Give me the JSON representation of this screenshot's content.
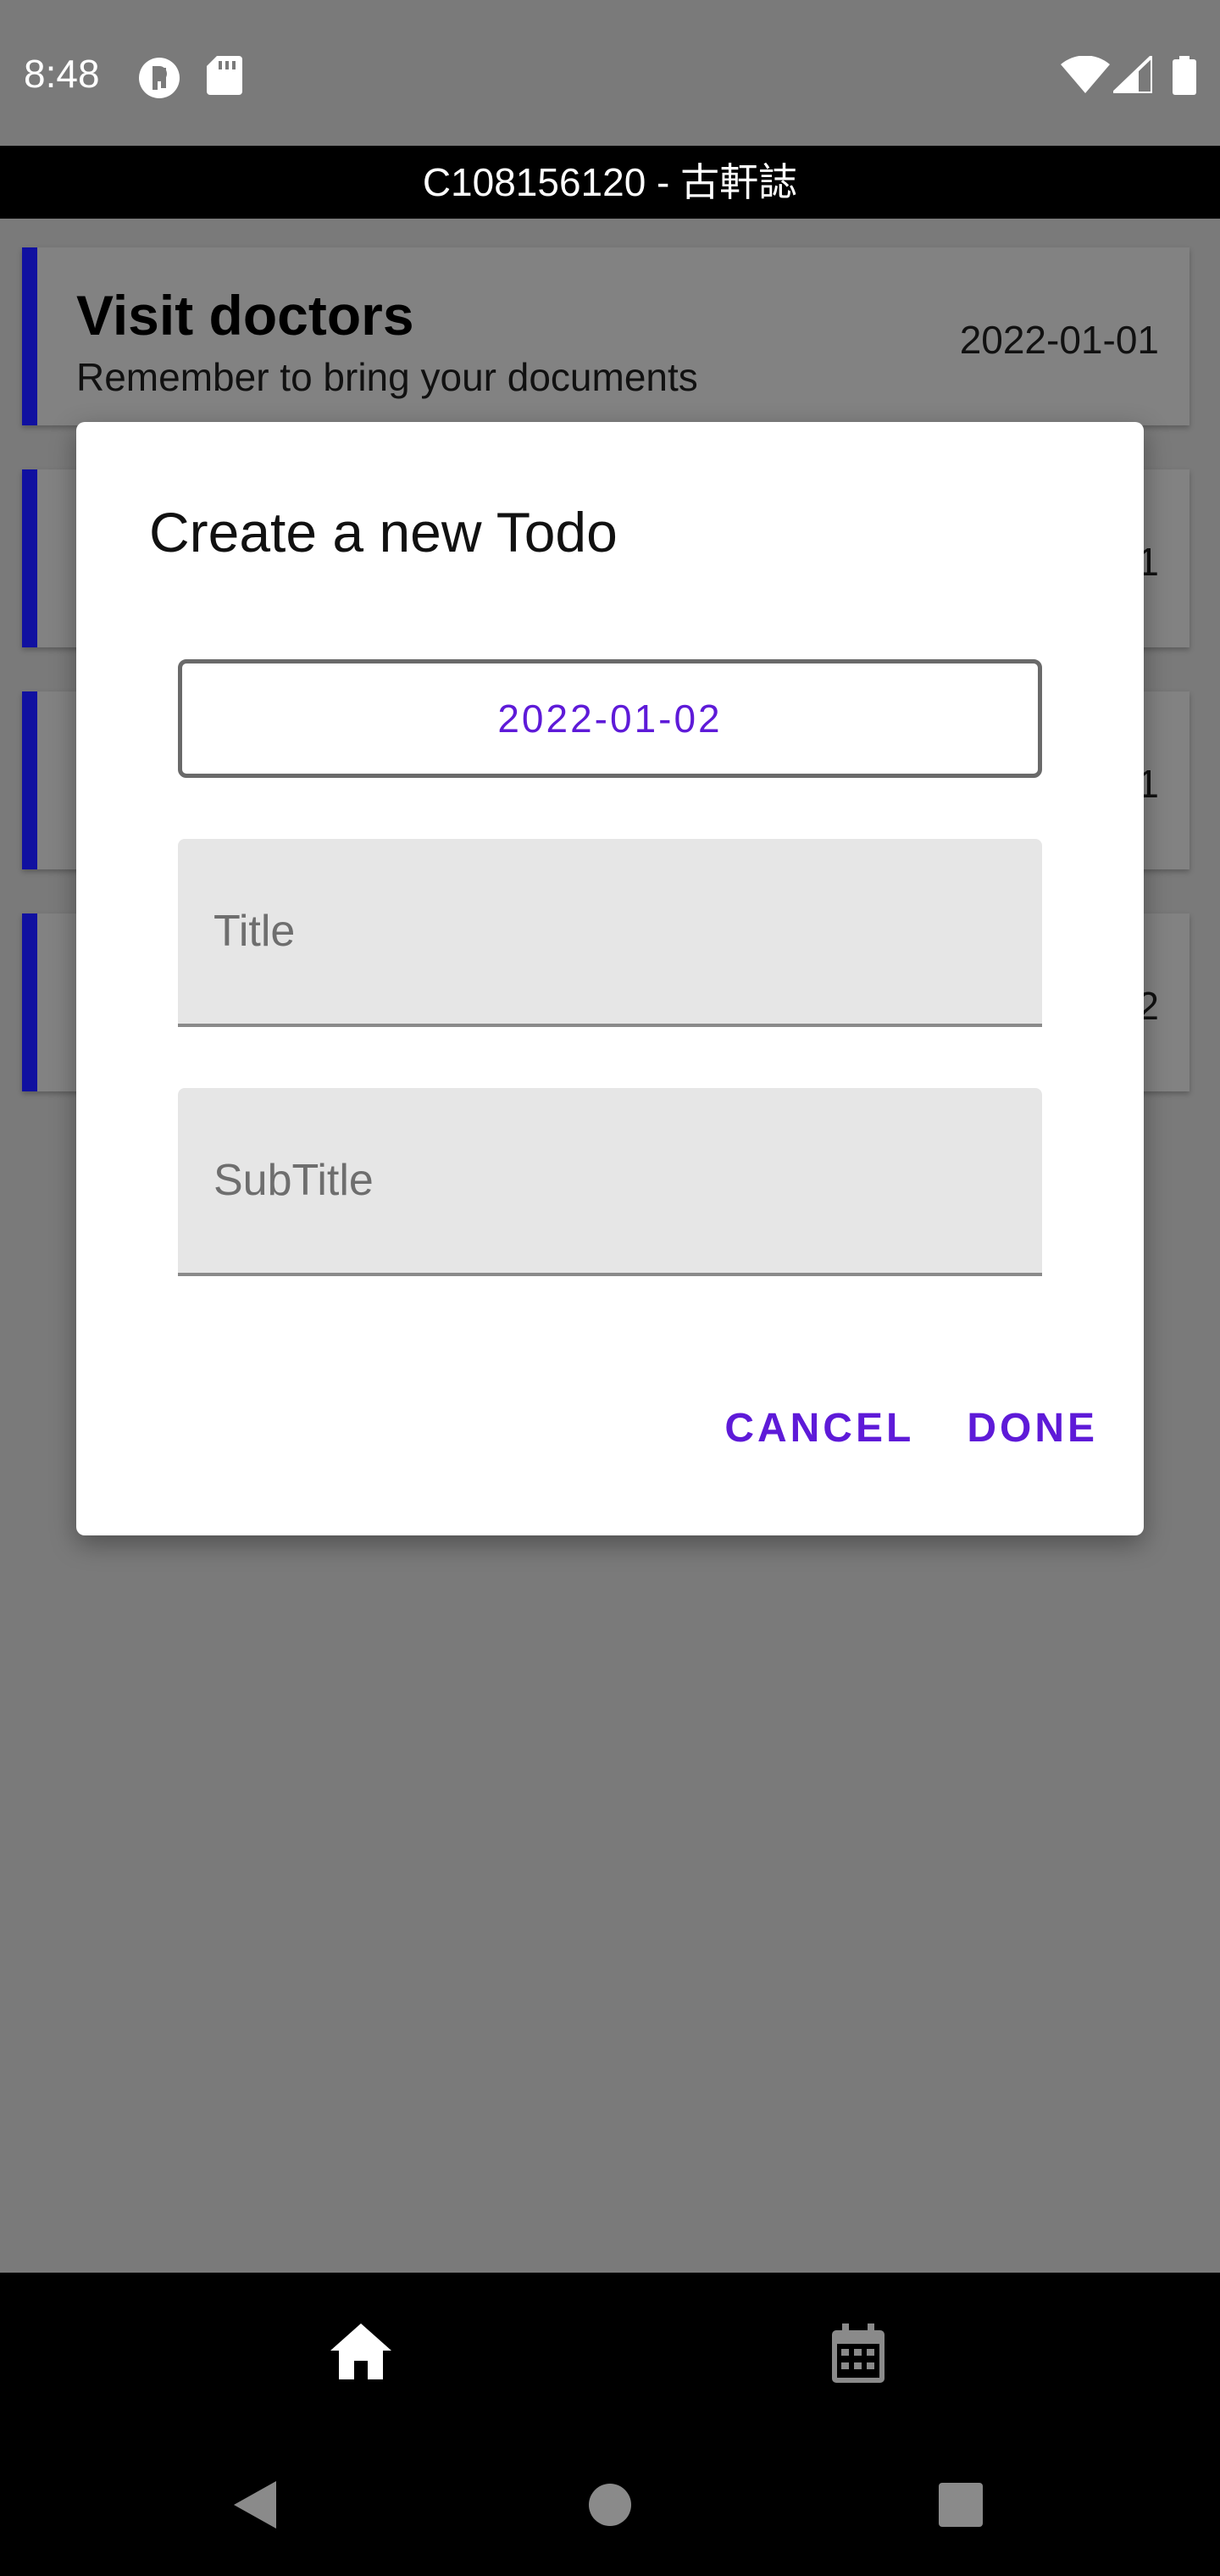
{
  "status_bar": {
    "time": "8:48",
    "icons": [
      "notification-p-icon",
      "sd-card-icon",
      "wifi-icon",
      "signal-icon",
      "battery-icon"
    ]
  },
  "app_bar": {
    "title": "C108156120 - 古軒誌"
  },
  "todos": [
    {
      "title": "Visit doctors",
      "subtitle": "Remember to bring your documents",
      "date": "2022-01-01"
    },
    {
      "title": "",
      "subtitle": "",
      "date": "1"
    },
    {
      "title": "",
      "subtitle": "",
      "date": "1"
    },
    {
      "title": "",
      "subtitle": "",
      "date": "2"
    }
  ],
  "dialog": {
    "title": "Create a new Todo",
    "date_value": "2022-01-02",
    "title_placeholder": "Title",
    "subtitle_placeholder": "SubTitle",
    "cancel_label": "CANCEL",
    "done_label": "DONE"
  },
  "bottom_nav": {
    "items": [
      "home-icon",
      "calendar-icon"
    ]
  },
  "colors": {
    "accent": "#5e1ad8",
    "card_bar": "#1010a0",
    "scrim": "#7a7a7a"
  }
}
